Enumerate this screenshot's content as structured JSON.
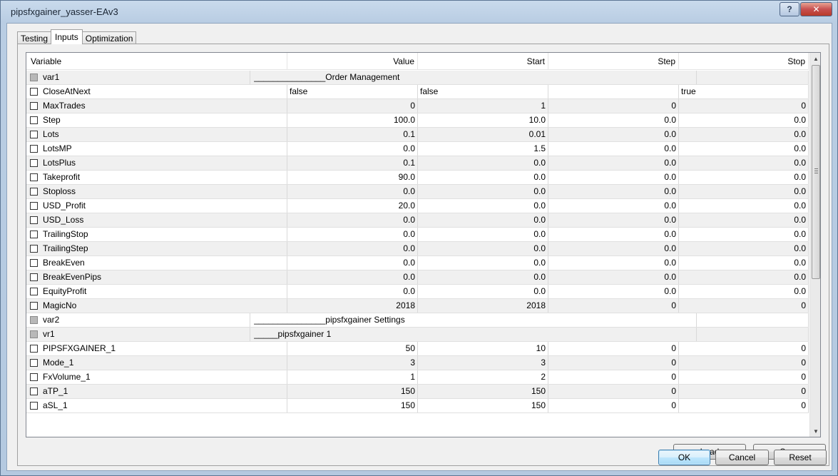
{
  "window": {
    "title": "pipsfxgainer_yasser-EAv3",
    "help_label": "?",
    "close_label": "✕"
  },
  "tabs": [
    {
      "label": "Testing",
      "active": false
    },
    {
      "label": "Inputs",
      "active": true
    },
    {
      "label": "Optimization",
      "active": false
    }
  ],
  "table": {
    "headers": {
      "variable": "Variable",
      "value": "Value",
      "start": "Start",
      "step": "Step",
      "stop": "Stop"
    },
    "rows": [
      {
        "name": "var1",
        "header": true,
        "value": "_______________Order Management"
      },
      {
        "name": "CloseAtNext",
        "value": "false",
        "start": "false",
        "step": "",
        "stop": "true",
        "text": true
      },
      {
        "name": "MaxTrades",
        "value": "0",
        "start": "1",
        "step": "0",
        "stop": "0"
      },
      {
        "name": "Step",
        "value": "100.0",
        "start": "10.0",
        "step": "0.0",
        "stop": "0.0"
      },
      {
        "name": "Lots",
        "value": "0.1",
        "start": "0.01",
        "step": "0.0",
        "stop": "0.0"
      },
      {
        "name": "LotsMP",
        "value": "0.0",
        "start": "1.5",
        "step": "0.0",
        "stop": "0.0"
      },
      {
        "name": "LotsPlus",
        "value": "0.1",
        "start": "0.0",
        "step": "0.0",
        "stop": "0.0"
      },
      {
        "name": "Takeprofit",
        "value": "90.0",
        "start": "0.0",
        "step": "0.0",
        "stop": "0.0"
      },
      {
        "name": "Stoploss",
        "value": "0.0",
        "start": "0.0",
        "step": "0.0",
        "stop": "0.0"
      },
      {
        "name": "USD_Profit",
        "value": "20.0",
        "start": "0.0",
        "step": "0.0",
        "stop": "0.0"
      },
      {
        "name": "USD_Loss",
        "value": "0.0",
        "start": "0.0",
        "step": "0.0",
        "stop": "0.0"
      },
      {
        "name": "TrailingStop",
        "value": "0.0",
        "start": "0.0",
        "step": "0.0",
        "stop": "0.0"
      },
      {
        "name": "TrailingStep",
        "value": "0.0",
        "start": "0.0",
        "step": "0.0",
        "stop": "0.0"
      },
      {
        "name": "BreakEven",
        "value": "0.0",
        "start": "0.0",
        "step": "0.0",
        "stop": "0.0"
      },
      {
        "name": "BreakEvenPips",
        "value": "0.0",
        "start": "0.0",
        "step": "0.0",
        "stop": "0.0"
      },
      {
        "name": "EquityProfit",
        "value": "0.0",
        "start": "0.0",
        "step": "0.0",
        "stop": "0.0"
      },
      {
        "name": "MagicNo",
        "value": "2018",
        "start": "2018",
        "step": "0",
        "stop": "0"
      },
      {
        "name": "var2",
        "header": true,
        "value": "_______________pipsfxgainer Settings"
      },
      {
        "name": "vr1",
        "header": true,
        "value": "_____pipsfxgainer 1"
      },
      {
        "name": "PIPSFXGAINER_1",
        "value": "50",
        "start": "10",
        "step": "0",
        "stop": "0"
      },
      {
        "name": "Mode_1",
        "value": "3",
        "start": "3",
        "step": "0",
        "stop": "0"
      },
      {
        "name": "FxVolume_1",
        "value": "1",
        "start": "2",
        "step": "0",
        "stop": "0"
      },
      {
        "name": "aTP_1",
        "value": "150",
        "start": "150",
        "step": "0",
        "stop": "0"
      },
      {
        "name": "aSL_1",
        "value": "150",
        "start": "150",
        "step": "0",
        "stop": "0"
      }
    ]
  },
  "scroll": {
    "up_icon": "▲",
    "down_icon": "▼"
  },
  "buttons": {
    "load": "Load",
    "save": "Save",
    "ok": "OK",
    "cancel": "Cancel",
    "reset": "Reset"
  }
}
